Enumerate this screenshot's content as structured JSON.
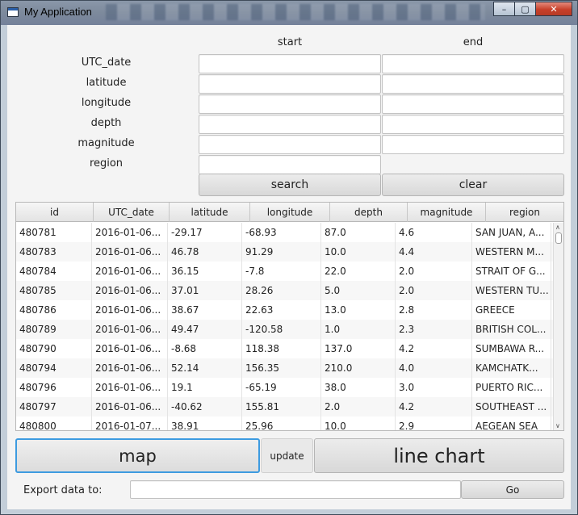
{
  "window": {
    "title": "My Application"
  },
  "form": {
    "col_start": "start",
    "col_end": "end",
    "labels": [
      "UTC_date",
      "latitude",
      "longitude",
      "depth",
      "magnitude",
      "region"
    ],
    "search_label": "search",
    "clear_label": "clear"
  },
  "table": {
    "columns": [
      "id",
      "UTC_date",
      "latitude",
      "longitude",
      "depth",
      "magnitude",
      "region"
    ],
    "rows": [
      [
        "480781",
        "2016-01-06...",
        "-29.17",
        "-68.93",
        "87.0",
        "4.6",
        "SAN JUAN, A..."
      ],
      [
        "480783",
        "2016-01-06...",
        "46.78",
        "91.29",
        "10.0",
        "4.4",
        "WESTERN M..."
      ],
      [
        "480784",
        "2016-01-06...",
        "36.15",
        "-7.8",
        "22.0",
        "2.0",
        "STRAIT OF G..."
      ],
      [
        "480785",
        "2016-01-06...",
        "37.01",
        "28.26",
        "5.0",
        "2.0",
        "WESTERN TU..."
      ],
      [
        "480786",
        "2016-01-06...",
        "38.67",
        "22.63",
        "13.0",
        "2.8",
        "GREECE"
      ],
      [
        "480789",
        "2016-01-06...",
        "49.47",
        "-120.58",
        "1.0",
        "2.3",
        "BRITISH COL..."
      ],
      [
        "480790",
        "2016-01-06...",
        "-8.68",
        "118.38",
        "137.0",
        "4.2",
        "SUMBAWA R..."
      ],
      [
        "480794",
        "2016-01-06...",
        "52.14",
        "156.35",
        "210.0",
        "4.0",
        "KAMCHATK..."
      ],
      [
        "480796",
        "2016-01-06...",
        "19.1",
        "-65.19",
        "38.0",
        "3.0",
        "PUERTO RIC..."
      ],
      [
        "480797",
        "2016-01-06...",
        "-40.62",
        "155.81",
        "2.0",
        "4.2",
        "SOUTHEAST ..."
      ],
      [
        "480800",
        "2016-01-07...",
        "38.91",
        "25.96",
        "10.0",
        "2.9",
        "AEGEAN SEA"
      ]
    ]
  },
  "actions": {
    "map_label": "map",
    "update_label": "update",
    "line_chart_label": "line chart"
  },
  "export": {
    "label": "Export data to:",
    "path_value": "",
    "go_label": "Go"
  }
}
